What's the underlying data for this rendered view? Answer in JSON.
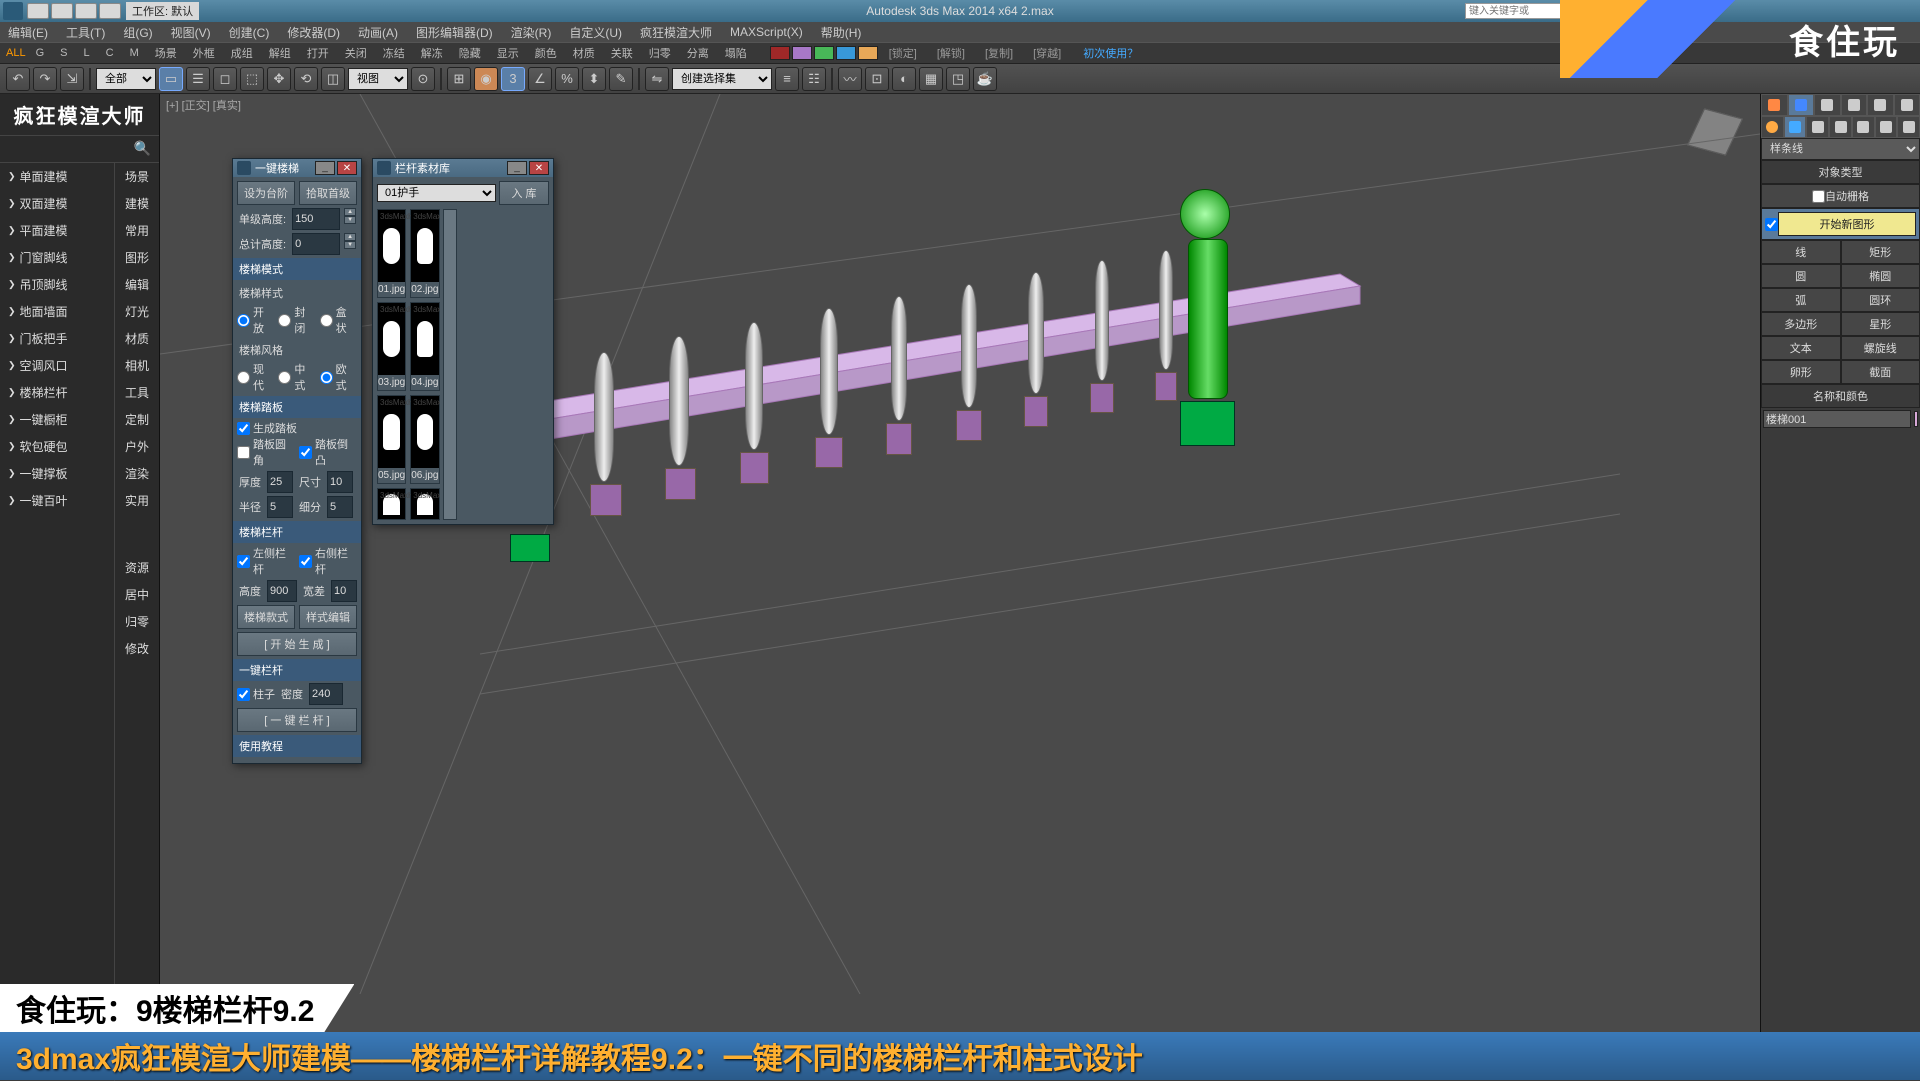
{
  "titlebar": {
    "workspace_label": "工作区: 默认",
    "title": "Autodesk 3ds Max  2014  x64      2.max",
    "search_placeholder": "键入关键字或"
  },
  "menubar": [
    "编辑(E)",
    "工具(T)",
    "组(G)",
    "视图(V)",
    "创建(C)",
    "修改器(D)",
    "动画(A)",
    "图形编辑器(D)",
    "渲染(R)",
    "自定义(U)",
    "疯狂模渲大师",
    "MAXScript(X)",
    "帮助(H)"
  ],
  "shelf": {
    "all": "ALL",
    "letters": [
      "G",
      "S",
      "L",
      "C",
      "M"
    ],
    "items": [
      "场景",
      "外框",
      "成组",
      "解组",
      "打开",
      "关闭",
      "冻结",
      "解冻",
      "隐藏",
      "显示",
      "颜色",
      "材质",
      "关联",
      "归零",
      "分离",
      "塌陷"
    ],
    "swatches": [
      "#a02828",
      "#a878c8",
      "#48b858",
      "#3898d8",
      "#e8a858"
    ],
    "brackets": [
      "[锁定]",
      "[解锁]",
      "[复制]",
      "[穿越]"
    ],
    "help": "初次使用？"
  },
  "toolbar": {
    "dropdown1": "全部",
    "dropdown2": "视图",
    "dropdown3": "创建选择集"
  },
  "leftpanel": {
    "title": "疯狂模渲大师",
    "col1": [
      "单面建模",
      "双面建模",
      "平面建模",
      "门窗脚线",
      "吊顶脚线",
      "地面墙面",
      "门板把手",
      "空调风口",
      "楼梯栏杆",
      "一键橱柜",
      "软包硬包",
      "一键撑板",
      "一键百叶"
    ],
    "col2": [
      "场景",
      "建模",
      "常用",
      "图形",
      "编辑",
      "灯光",
      "材质",
      "相机",
      "工具",
      "定制",
      "户外",
      "渲染",
      "实用",
      "",
      "资源",
      "居中",
      "归零",
      "修改"
    ]
  },
  "viewport": {
    "label": "[+] [正交] [真实]"
  },
  "rightpanel": {
    "dropdown": "样条线",
    "section1": "对象类型",
    "autogrid": "自动栅格",
    "start_shape": "开始新图形",
    "grid": [
      "线",
      "矩形",
      "圆",
      "椭圆",
      "弧",
      "圆环",
      "多边形",
      "星形",
      "文本",
      "螺旋线",
      "卵形",
      "截面"
    ],
    "section2": "名称和颜色",
    "objname": "楼梯001"
  },
  "dialog1": {
    "title": "一键楼梯",
    "btn1": "设为台阶",
    "btn2": "拾取首级",
    "lbl_height": "单级高度:",
    "val_height": "150",
    "lbl_total": "总计高度:",
    "val_total": "0",
    "hdr1": "楼梯模式",
    "lbl_style": "楼梯样式",
    "r_open": "开放",
    "r_close": "封闭",
    "r_box": "盒状",
    "lbl_stairstyle": "楼梯风格",
    "r_modern": "现代",
    "r_chinese": "中式",
    "r_euro": "欧式",
    "hdr2": "楼梯踏板",
    "chk_gen": "生成踏板",
    "chk_round": "踏板圆角",
    "chk_convex": "踏板倒凸",
    "lbl_thick": "厚度",
    "val_thick": "25",
    "lbl_size": "尺寸",
    "val_size": "10",
    "lbl_rad": "半径",
    "val_rad": "5",
    "lbl_seg": "细分",
    "val_seg": "5",
    "hdr3": "楼梯栏杆",
    "chk_left": "左侧栏杆",
    "chk_right": "右侧栏杆",
    "lbl_h2": "高度",
    "val_h2": "900",
    "lbl_gap": "宽差",
    "val_gap": "10",
    "btn_style": "楼梯款式",
    "btn_edit": "样式编辑",
    "btn_gen": "[ 开 始 生 成 ]",
    "hdr4": "一键栏杆",
    "chk_post": "柱子",
    "lbl_density": "密度",
    "val_density": "240",
    "btn_rail": "[ 一 键 栏 杆 ]",
    "hdr5": "使用教程"
  },
  "dialog2": {
    "title": "栏杆素材库",
    "dropdown": "01护手",
    "btn_in": "入 库",
    "items": [
      "01.jpg",
      "02.jpg",
      "03.jpg",
      "04.jpg",
      "05.jpg",
      "06.jpg"
    ]
  },
  "watermark": "食住玩",
  "banner1": "食住玩：9楼梯栏杆9.2",
  "banner2": "3dmax疯狂模渲大师建模——楼梯栏杆详解教程9.2：一键不同的楼梯栏杆和柱式设计"
}
